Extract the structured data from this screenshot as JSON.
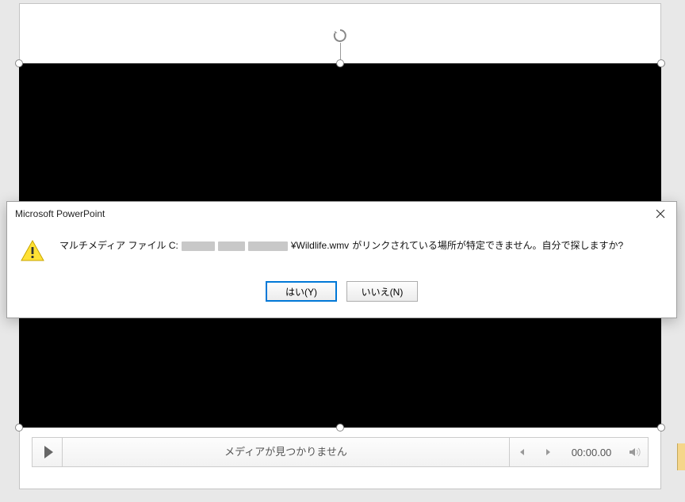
{
  "dialog": {
    "title": "Microsoft PowerPoint",
    "message_prefix": "マルチメディア ファイル C:",
    "message_filename": "¥Wildlife.wmv",
    "message_suffix": "がリンクされている場所が特定できません。自分で探しますか?",
    "yes_label": "はい(Y)",
    "no_label": "いいえ(N)"
  },
  "media_bar": {
    "status_text": "メディアが見つかりません",
    "time": "00:00.00"
  }
}
